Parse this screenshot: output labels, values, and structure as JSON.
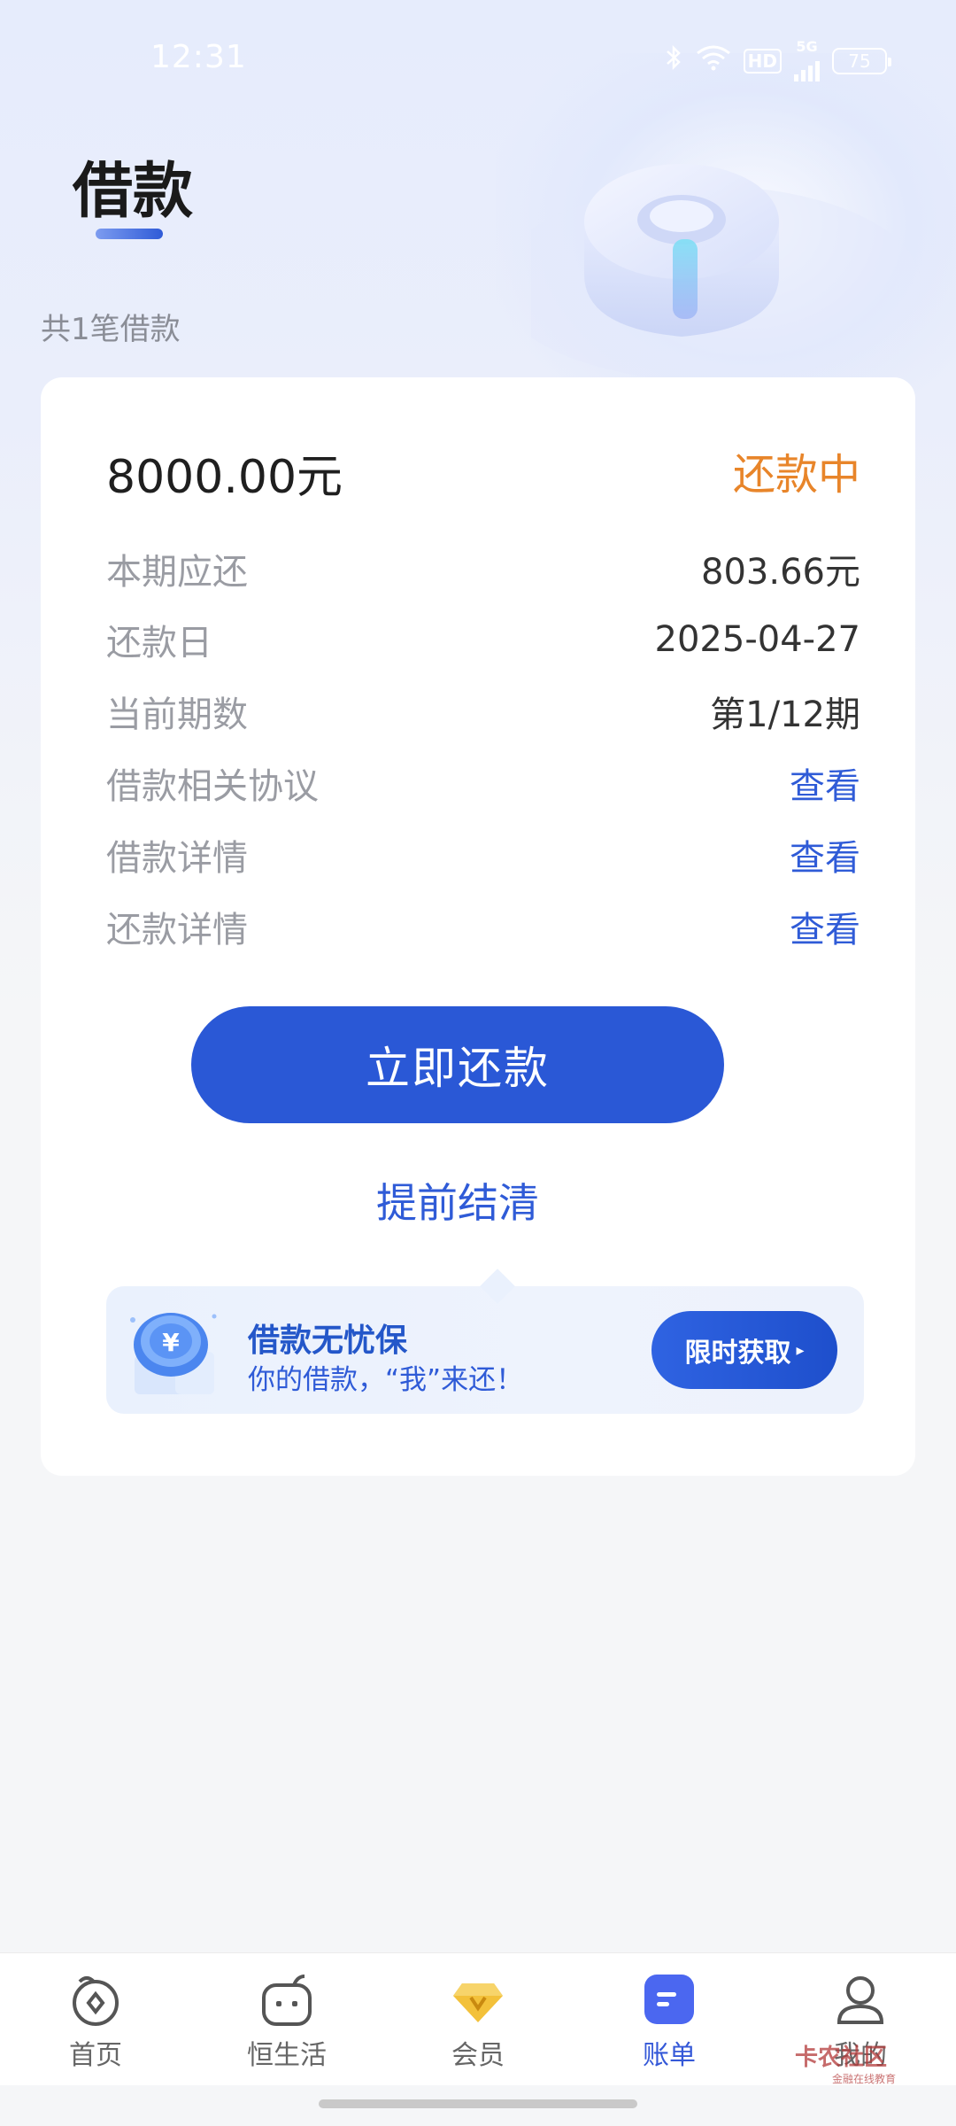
{
  "status_bar": {
    "time": "12:31",
    "hd_label": "HD",
    "network": "5G",
    "battery": "75"
  },
  "header": {
    "title": "借款",
    "loan_count": "共1笔借款"
  },
  "loan_card": {
    "amount": "8000.00元",
    "status": "还款中",
    "rows": [
      {
        "label": "本期应还",
        "value": "803.66元"
      },
      {
        "label": "还款日",
        "value": "2025-04-27"
      },
      {
        "label": "当前期数",
        "value": "第1/12期"
      },
      {
        "label": "借款相关协议",
        "link": "查看"
      },
      {
        "label": "借款详情",
        "link": "查看"
      },
      {
        "label": "还款详情",
        "link": "查看"
      }
    ],
    "repay_button": "立即还款",
    "early_settle": "提前结清",
    "promo": {
      "title": "借款无忧保",
      "subtitle": "你的借款，“我”来还！",
      "button": "限时获取",
      "coin_symbol": "¥"
    }
  },
  "bottom_nav": [
    {
      "label": "首页",
      "icon": "home-icon"
    },
    {
      "label": "恒生活",
      "icon": "life-icon"
    },
    {
      "label": "会员",
      "icon": "member-diamond-icon"
    },
    {
      "label": "账单",
      "icon": "bill-icon",
      "active": true
    },
    {
      "label": "我的",
      "icon": "profile-icon"
    }
  ],
  "watermark": {
    "text": "卡农社区",
    "sub": "金融在线教育"
  },
  "colors": {
    "primary": "#2a58d6",
    "status_orange": "#e8852a",
    "link_blue": "#2f5bd7"
  }
}
